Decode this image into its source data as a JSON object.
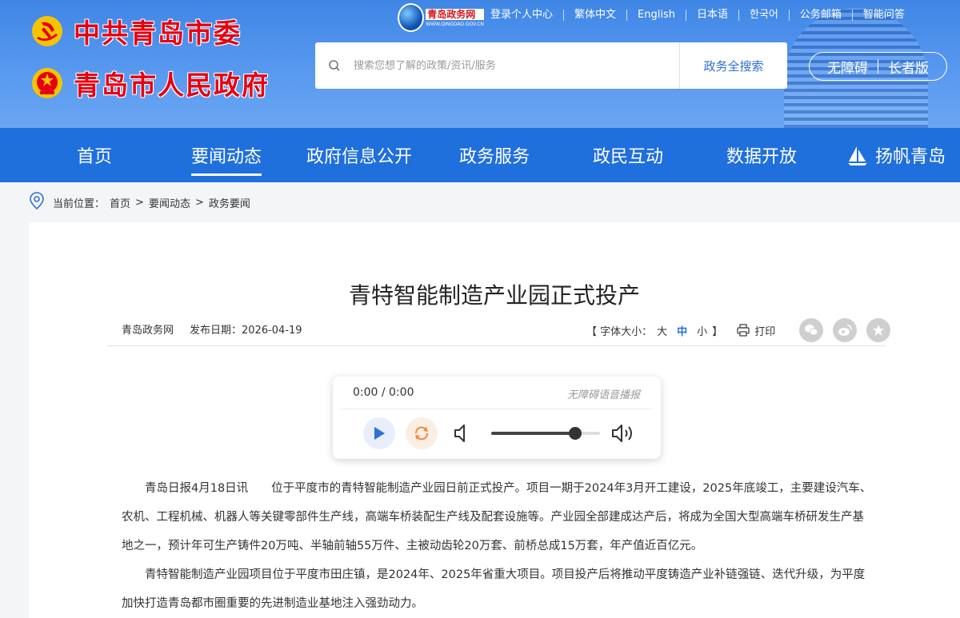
{
  "header": {
    "party_title": "中共青岛市委",
    "gov_title": "青岛市人民政府",
    "site_logo_text": "青岛政务网",
    "site_logo_sub": "WWW.QINGDAO.GOV.CN",
    "top_links": [
      "登录个人中心",
      "繁体中文",
      "English",
      "日本语",
      "한국어",
      "公务邮箱",
      "智能问答"
    ],
    "search": {
      "placeholder": "搜索您想了解的政策/资讯/服务",
      "button": "政务全搜索"
    },
    "accessibility": {
      "barrier_free": "无障碍",
      "elder": "长者版"
    }
  },
  "nav": {
    "items": [
      "首页",
      "要闻动态",
      "政府信息公开",
      "政务服务",
      "政民互动",
      "数据开放",
      "扬帆青岛"
    ],
    "active": "要闻动态"
  },
  "breadcrumb": {
    "prefix": "当前位置：",
    "items": [
      "首页",
      ">",
      "要闻动态",
      ">",
      "政务要闻"
    ]
  },
  "article": {
    "title": "青特智能制造产业园正式投产",
    "source": "青岛政务网",
    "date_label": "发布日期：2026-04-19",
    "font_size": {
      "open": "【 字体大小：",
      "large": "大",
      "medium": "中",
      "small": "小",
      "close": "】"
    },
    "print": "打印",
    "paragraphs": [
      "青岛日报4月18日讯　　位于平度市的青特智能制造产业园日前正式投产。项目一期于2024年3月开工建设，2025年底竣工，主要建设汽车、农机、工程机械、机器人等关键零部件生产线，高端车桥装配生产线及配套设施等。产业园全部建成达产后，将成为全国大型高端车桥研发生产基地之一，预计年可生产铸件20万吨、半轴前轴55万件、主被动齿轮20万套、前桥总成15万套，年产值近百亿元。",
      "青特智能制造产业园项目位于平度市田庄镇，是2024年、2025年省重大项目。项目投产后将推动平度铸造产业补链强链、迭代升级，为平度加快打造青岛都市圈重要的先进制造业基地注入强劲动力。"
    ]
  },
  "audio": {
    "time": "0:00 / 0:00",
    "label": "无障碍语音播报",
    "volume": 0.77
  },
  "colors": {
    "brand_blue": "#1f6fdd",
    "party_red": "#e60012"
  }
}
